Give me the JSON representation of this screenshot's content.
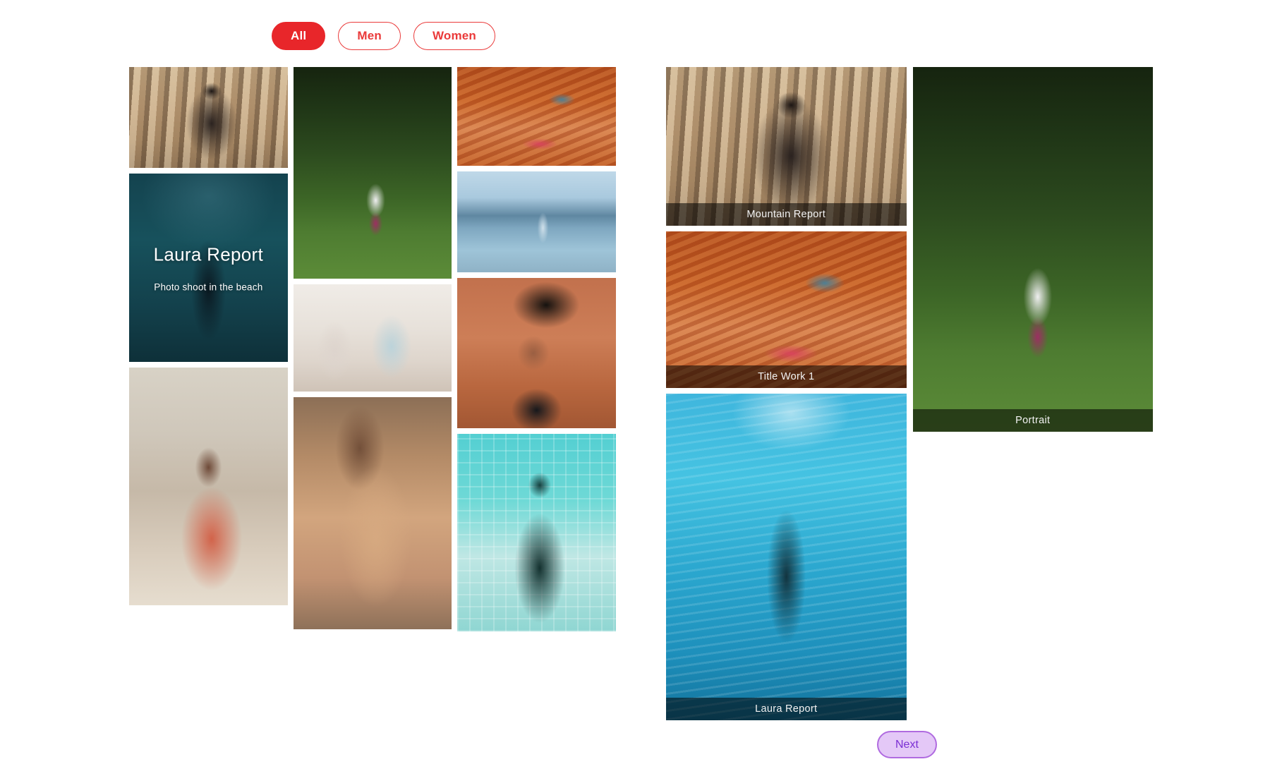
{
  "filters": {
    "items": [
      {
        "label": "All",
        "active": true
      },
      {
        "label": "Men",
        "active": false
      },
      {
        "label": "Women",
        "active": false
      }
    ],
    "active_color": "#e8262a",
    "outline_color": "#ea3a3a"
  },
  "gallery_left": {
    "tiles": [
      {
        "name": "forest-sepia-woman",
        "alt": "Woman in black hat standing in sepia-toned forest"
      },
      {
        "name": "underwater-laura",
        "alt": "Silhouette of woman walking underwater in dark teal water",
        "title": "Laura Report",
        "subtitle": "Photo shoot in the beach"
      },
      {
        "name": "coral-dress-woman",
        "alt": "Woman in coral dress with round sunglasses sitting on steps"
      },
      {
        "name": "orchard-woman-chair",
        "alt": "Woman on red chair in green apple orchard"
      },
      {
        "name": "shop-two-women",
        "alt": "Two women looking at items in a bright shop"
      },
      {
        "name": "back-portrait-woman",
        "alt": "Woman resting head on arm, bare back portrait"
      },
      {
        "name": "redhead-closeup",
        "alt": "Close-up of redhead woman with hair across face"
      },
      {
        "name": "lake-dock-man",
        "alt": "Man standing on dock with mountains and lake behind"
      },
      {
        "name": "hat-sunglasses-man",
        "alt": "Man with wide black hat and sunglasses on terracotta wall"
      },
      {
        "name": "cap-man-pool-wall",
        "alt": "Man in dark cap and polo against cyan tiled wall"
      }
    ]
  },
  "gallery_right": {
    "tiles": [
      {
        "name": "mountain-report",
        "caption": "Mountain Report",
        "alt": "Woman in black hat in sepia forest"
      },
      {
        "name": "title-work-1",
        "caption": "Title Work 1",
        "alt": "Close-up of redhead woman"
      },
      {
        "name": "laura-report",
        "caption": "Laura Report",
        "alt": "Swimmer underwater in bright turquoise water"
      },
      {
        "name": "portrait",
        "caption": "Portrait",
        "alt": "Woman on red chair in green orchard"
      }
    ],
    "caption_background": "rgba(0,0,0,0.55)",
    "caption_color": "#f2f2f2"
  },
  "pagination": {
    "next_label": "Next",
    "next_text_color": "#7b2fd4",
    "next_background": "#e4c8f7",
    "next_border_color": "#b06be0"
  }
}
